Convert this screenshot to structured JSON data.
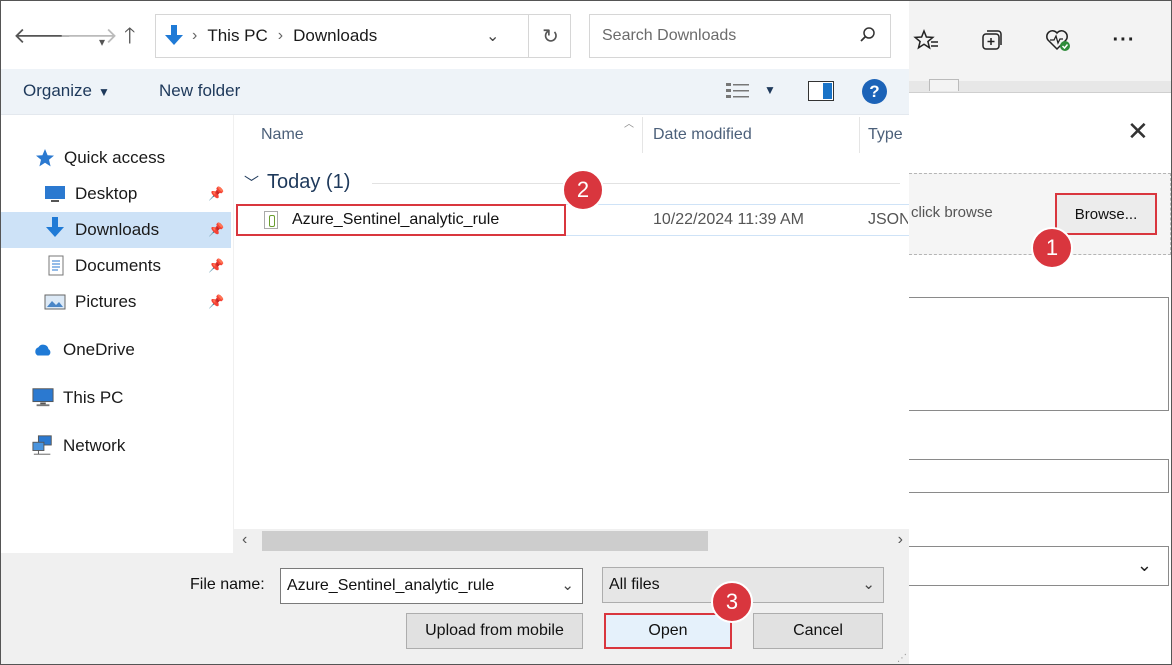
{
  "address_bar": {
    "path": [
      "This PC",
      "Downloads"
    ],
    "separator": "›"
  },
  "search": {
    "placeholder": "Search Downloads"
  },
  "command_bar": {
    "organize": "Organize",
    "new_folder": "New folder",
    "help": "?"
  },
  "nav_pane": {
    "items": [
      {
        "label": "Quick access",
        "icon": "star-icon"
      },
      {
        "label": "Desktop",
        "icon": "desktop-icon",
        "pinned": true
      },
      {
        "label": "Downloads",
        "icon": "download-arrow-icon",
        "pinned": true,
        "selected": true
      },
      {
        "label": "Documents",
        "icon": "document-icon",
        "pinned": true
      },
      {
        "label": "Pictures",
        "icon": "pictures-icon",
        "pinned": true
      },
      {
        "label": "OneDrive",
        "icon": "cloud-icon"
      },
      {
        "label": "This PC",
        "icon": "computer-icon"
      },
      {
        "label": "Network",
        "icon": "network-icon"
      }
    ]
  },
  "file_list": {
    "columns": [
      "Name",
      "Date modified",
      "Type"
    ],
    "group": "Today (1)",
    "files": [
      {
        "name": "Azure_Sentinel_analytic_rule",
        "date_modified": "10/22/2024 11:39 AM",
        "type": "JSON"
      }
    ]
  },
  "bottom": {
    "file_name_label": "File name:",
    "file_name_value": "Azure_Sentinel_analytic_rule",
    "filter_value": "All files",
    "upload_label": "Upload from mobile",
    "open_label": "Open",
    "cancel_label": "Cancel"
  },
  "background_panel": {
    "drop_hint": "click browse",
    "browse_label": "Browse...",
    "close": "✕"
  },
  "callouts": [
    "1",
    "2",
    "3"
  ],
  "colors": {
    "accent": "#1c63b8",
    "callout": "#d9363e",
    "selection": "#cde2f7"
  }
}
